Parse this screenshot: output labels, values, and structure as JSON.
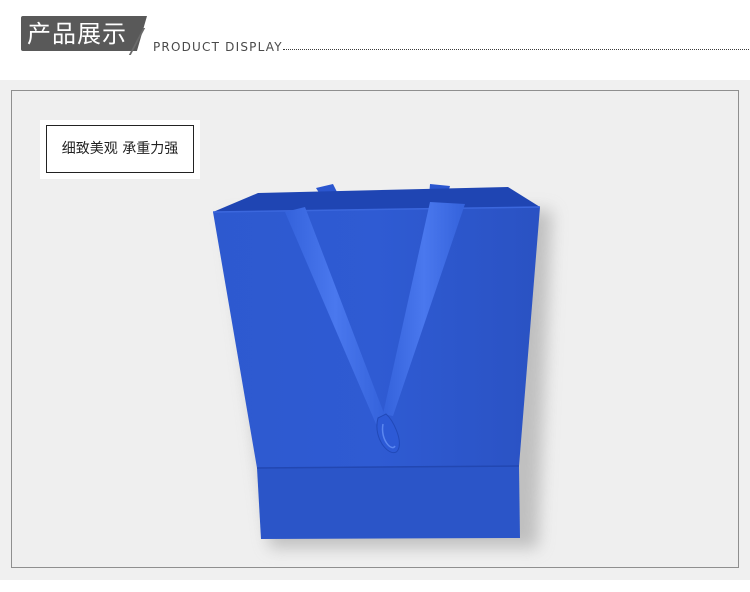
{
  "header": {
    "title": "产品展示",
    "subtitle": "PRODUCT DISPLAY"
  },
  "gallery": {
    "caption": "细致美观 承重力强",
    "product_image": "blue-gift-bag-with-ribbon-handles"
  },
  "colors": {
    "title_bg": "#595959",
    "bag_blue": "#2b55c8",
    "bag_dark": "#1f43aa",
    "ribbon": "#3a67dd",
    "frame_bg": "#efefef"
  }
}
